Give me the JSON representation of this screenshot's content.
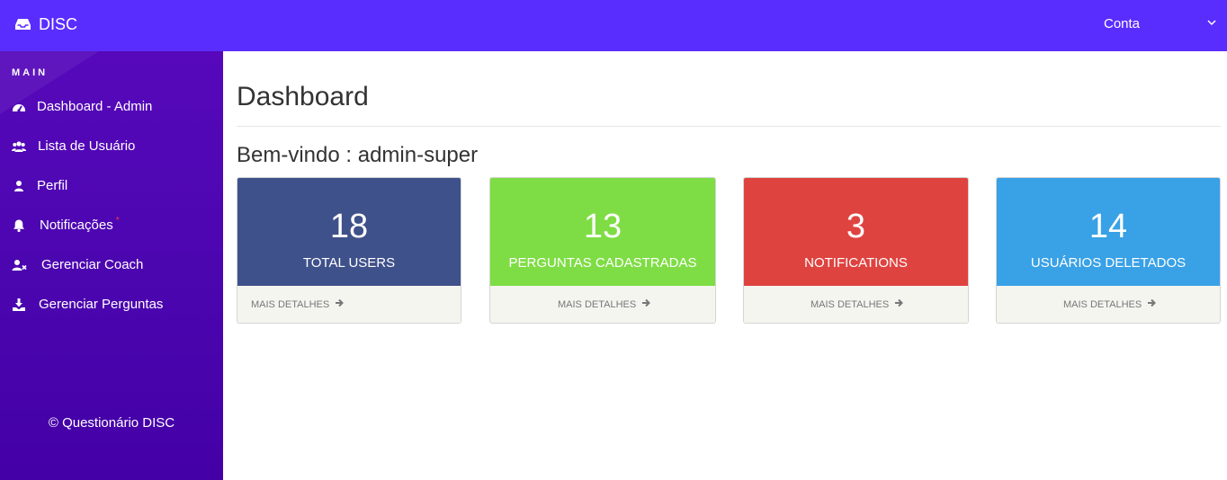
{
  "header": {
    "brand": "DISC",
    "account_label": "Conta"
  },
  "colors": {
    "topbar": "#5a2dff",
    "sidebar": "#4c06b0",
    "users": "#3f518a",
    "perguntas": "#7edd44",
    "notifications": "#df4340",
    "deletados": "#39a1e6",
    "footer_bg": "#f5f5f0"
  },
  "sidebar": {
    "section_title": "MAIN",
    "items": [
      {
        "label": "Dashboard - Admin",
        "icon": "dashboard-icon"
      },
      {
        "label": "Lista de Usuário",
        "icon": "users-icon"
      },
      {
        "label": "Perfil",
        "icon": "user-icon"
      },
      {
        "label": "Notificações",
        "icon": "bell-icon",
        "badge": "*"
      },
      {
        "label": "Gerenciar Coach",
        "icon": "user-remove-icon"
      },
      {
        "label": "Gerenciar Perguntas",
        "icon": "download-icon"
      }
    ],
    "footer": "© Questionário DISC"
  },
  "main": {
    "title": "Dashboard",
    "welcome": "Bem-vindo : admin-super",
    "cards": [
      {
        "value": "18",
        "label": "TOTAL USERS",
        "link": "MAIS DETALHES"
      },
      {
        "value": "13",
        "label": "PERGUNTAS CADASTRADAS",
        "link": "MAIS DETALHES"
      },
      {
        "value": "3",
        "label": "NOTIFICATIONS",
        "link": "MAIS DETALHES"
      },
      {
        "value": "14",
        "label": "USUÁRIOS DELETADOS",
        "link": "MAIS DETALHES"
      }
    ]
  }
}
